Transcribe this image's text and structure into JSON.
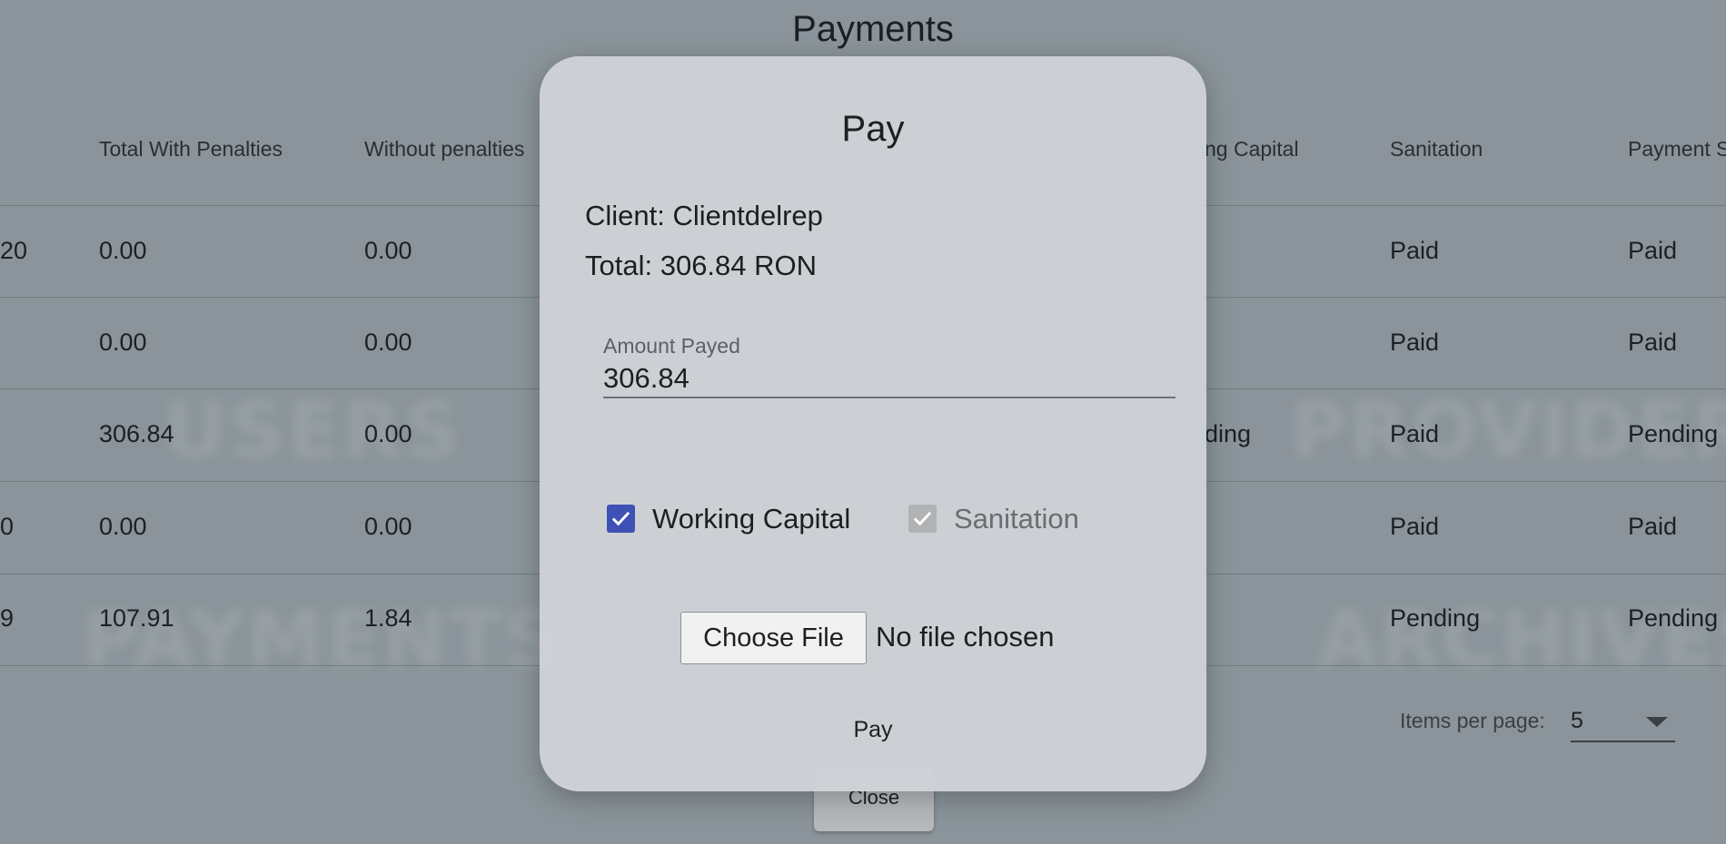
{
  "page": {
    "title": "Payments",
    "background_words": [
      "USERS",
      "PAYMENTS",
      "PROVIDER",
      "ARCHIVES"
    ]
  },
  "table": {
    "headers": [
      "Total With Penalties",
      "Without penalties",
      "ng Capital",
      "Sanitation",
      "Payment S"
    ],
    "rows": [
      {
        "lead": "20",
        "total_with_penalties": "0.00",
        "without_penalties": "0.00",
        "working_capital": "",
        "sanitation": "Paid",
        "payment_status": "Paid"
      },
      {
        "lead": "",
        "total_with_penalties": "0.00",
        "without_penalties": "0.00",
        "working_capital": "",
        "sanitation": "Paid",
        "payment_status": "Paid"
      },
      {
        "lead": "",
        "total_with_penalties": "306.84",
        "without_penalties": "0.00",
        "working_capital": "ding",
        "sanitation": "Paid",
        "payment_status": "Pending"
      },
      {
        "lead": "0",
        "total_with_penalties": "0.00",
        "without_penalties": "0.00",
        "working_capital": "",
        "sanitation": "Paid",
        "payment_status": "Paid"
      },
      {
        "lead": "9",
        "total_with_penalties": "107.91",
        "without_penalties": "1.84",
        "working_capital": "",
        "sanitation": "Pending",
        "payment_status": "Pending"
      }
    ]
  },
  "paginator": {
    "label": "Items per page:",
    "value": "5"
  },
  "close_button": "Close",
  "modal": {
    "title": "Pay",
    "client_line": "Client: Clientdelrep",
    "total_line": "Total: 306.84 RON",
    "amount_label": "Amount Payed",
    "amount_value": "306.84",
    "checkbox_working_capital": "Working Capital",
    "checkbox_sanitation": "Sanitation",
    "file_button": "Choose File",
    "file_status": "No file chosen",
    "pay_button": "Pay"
  },
  "colors": {
    "accent": "#3f51b5"
  }
}
